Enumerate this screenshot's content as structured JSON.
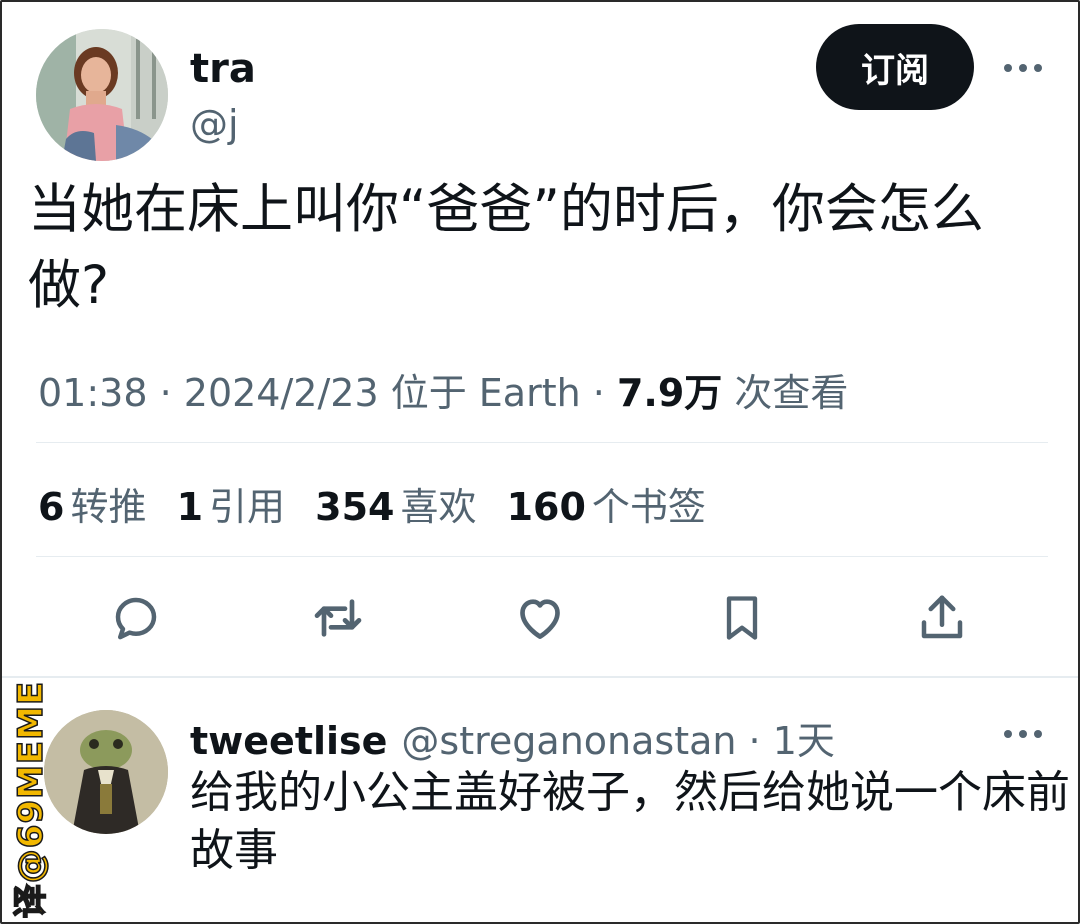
{
  "tweet": {
    "author_name": "tra",
    "author_handle": "@j",
    "subscribe_label": "订阅",
    "text": "当她在床上叫你“爸爸”的时后，你会怎么做?",
    "meta": {
      "time": "01:38",
      "date": "2024/2/23",
      "location": "位于 Earth",
      "views_count": "7.9万",
      "views_label": "次查看"
    },
    "stats": [
      {
        "count": "6",
        "label": "转推"
      },
      {
        "count": "1",
        "label": "引用"
      },
      {
        "count": "354",
        "label": "喜欢"
      },
      {
        "count": "160",
        "label": "个书签"
      }
    ],
    "actions": [
      "reply-icon",
      "retweet-icon",
      "like-icon",
      "bookmark-icon",
      "share-icon"
    ]
  },
  "reply": {
    "author_name": "tweetlise",
    "author_handle": "@streganonastan",
    "time": "1天",
    "text": "给我的小公主盖好被子，然后给她说一个床前故事"
  },
  "watermark": "译@69MEME",
  "colors": {
    "text_primary": "#0f1419",
    "text_secondary": "#536471",
    "button_bg": "#0f1419",
    "divider": "#e6ecf0",
    "watermark": "#f2b800"
  }
}
